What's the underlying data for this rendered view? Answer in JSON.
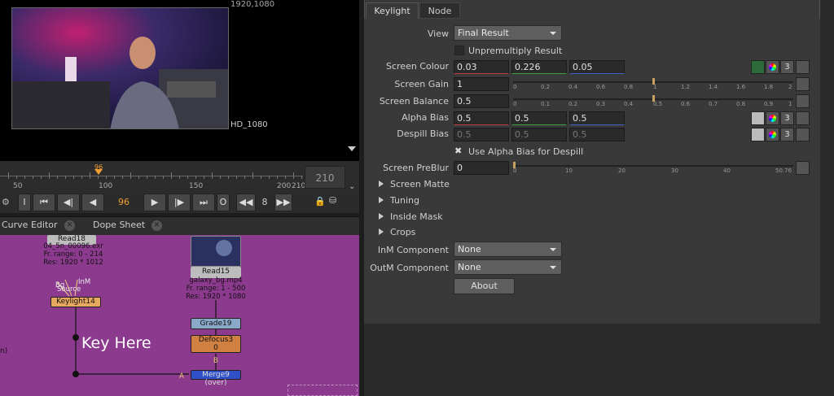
{
  "viewer": {
    "resolution": "1920,1080",
    "format": "HD_1080"
  },
  "timeline": {
    "ticks": [
      "50",
      "100",
      "150",
      "200",
      "210"
    ],
    "playhead": "96",
    "end_frame": "210"
  },
  "transport": {
    "i_label": "I",
    "frame": "96",
    "o_label": "O",
    "step": "8"
  },
  "bottom_tabs": [
    "Curve Editor",
    "Dope Sheet"
  ],
  "graph": {
    "read18": {
      "name": "Read18",
      "file": "04_5n_00096.exr",
      "range": "Fr. range: 0 - 214",
      "res": "Res: 1920 * 1012"
    },
    "read15": {
      "name": "Read15",
      "file": "galaxy_bg.mp4",
      "range": "Fr. range: 1 - 500",
      "res": "Res: 1920 * 1080"
    },
    "keylight": "Keylight14",
    "grade": "Grade19",
    "defocus": "Defocus3",
    "defocus_val": "0",
    "merge": "Merge9 (over)",
    "key_label": "Key Here",
    "in_labels": [
      "Bg",
      "Source",
      "InM"
    ],
    "b_label": "B",
    "a_label": "A",
    "edge_text": "n)"
  },
  "panel": {
    "tabs": [
      "Keylight",
      "Node"
    ],
    "view_label": "View",
    "view_value": "Final Result",
    "unpremultiply": "Unpremultiply Result",
    "screen_colour_label": "Screen Colour",
    "screen_colour": [
      "0.03",
      "0.226",
      "0.05"
    ],
    "screen_gain_label": "Screen Gain",
    "screen_gain": "1",
    "gain_ticks": [
      "0",
      "0.2",
      "0.4",
      "0.6",
      "0.8",
      "1",
      "1.2",
      "1.4",
      "1.6",
      "1.8",
      "2"
    ],
    "screen_balance_label": "Screen Balance",
    "screen_balance": "0.5",
    "balance_ticks": [
      "0",
      "0.1",
      "0.2",
      "0.3",
      "0.4",
      "0.5",
      "0.6",
      "0.7",
      "0.8",
      "0.9",
      "1"
    ],
    "alpha_bias_label": "Alpha Bias",
    "alpha_bias": [
      "0.5",
      "0.5",
      "0.5"
    ],
    "despill_bias_label": "Despill Bias",
    "despill_bias": [
      "0.5",
      "0.5",
      "0.5"
    ],
    "use_alpha_bias": "Use Alpha Bias for Despill",
    "preblur_label": "Screen PreBlur",
    "preblur": "0",
    "preblur_ticks": [
      "0",
      "10",
      "20",
      "30",
      "40",
      "50",
      "76"
    ],
    "preblur_end": "50.76",
    "sections": [
      "Screen Matte",
      "Tuning",
      "Inside Mask",
      "Crops"
    ],
    "inm_label": "InM Component",
    "inm_value": "None",
    "outm_label": "OutM Component",
    "outm_value": "None",
    "about": "About",
    "channel_count": "3"
  },
  "colors": {
    "graph_bg": "#8c3a8e",
    "accent": "#f0a030",
    "panel_bg": "#393939"
  }
}
